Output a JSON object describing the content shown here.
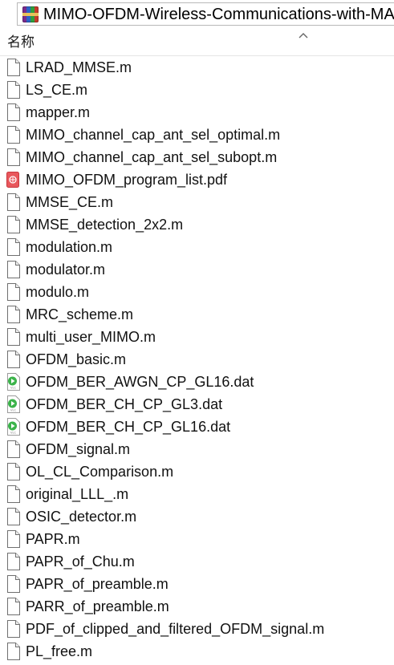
{
  "window": {
    "path_title": "MIMO-OFDM-Wireless-Communications-with-MA"
  },
  "header": {
    "name_column": "名称"
  },
  "files": [
    {
      "name": "LRAD_MMSE.m",
      "icon": "file-icon"
    },
    {
      "name": "LS_CE.m",
      "icon": "file-icon"
    },
    {
      "name": "mapper.m",
      "icon": "file-icon"
    },
    {
      "name": "MIMO_channel_cap_ant_sel_optimal.m",
      "icon": "file-icon"
    },
    {
      "name": "MIMO_channel_cap_ant_sel_subopt.m",
      "icon": "file-icon"
    },
    {
      "name": "MIMO_OFDM_program_list.pdf",
      "icon": "pdf-icon"
    },
    {
      "name": "MMSE_CE.m",
      "icon": "file-icon"
    },
    {
      "name": "MMSE_detection_2x2.m",
      "icon": "file-icon"
    },
    {
      "name": "modulation.m",
      "icon": "file-icon"
    },
    {
      "name": "modulator.m",
      "icon": "file-icon"
    },
    {
      "name": "modulo.m",
      "icon": "file-icon"
    },
    {
      "name": "MRC_scheme.m",
      "icon": "file-icon"
    },
    {
      "name": "multi_user_MIMO.m",
      "icon": "file-icon"
    },
    {
      "name": "OFDM_basic.m",
      "icon": "file-icon"
    },
    {
      "name": "OFDM_BER_AWGN_CP_GL16.dat",
      "icon": "media-icon"
    },
    {
      "name": "OFDM_BER_CH_CP_GL3.dat",
      "icon": "media-icon"
    },
    {
      "name": "OFDM_BER_CH_CP_GL16.dat",
      "icon": "media-icon"
    },
    {
      "name": "OFDM_signal.m",
      "icon": "file-icon"
    },
    {
      "name": "OL_CL_Comparison.m",
      "icon": "file-icon"
    },
    {
      "name": "original_LLL_.m",
      "icon": "file-icon"
    },
    {
      "name": "OSIC_detector.m",
      "icon": "file-icon"
    },
    {
      "name": "PAPR.m",
      "icon": "file-icon"
    },
    {
      "name": "PAPR_of_Chu.m",
      "icon": "file-icon"
    },
    {
      "name": "PAPR_of_preamble.m",
      "icon": "file-icon"
    },
    {
      "name": "PARR_of_preamble.m",
      "icon": "file-icon"
    },
    {
      "name": "PDF_of_clipped_and_filtered_OFDM_signal.m",
      "icon": "file-icon"
    },
    {
      "name": "PL_free.m",
      "icon": "file-icon"
    }
  ]
}
